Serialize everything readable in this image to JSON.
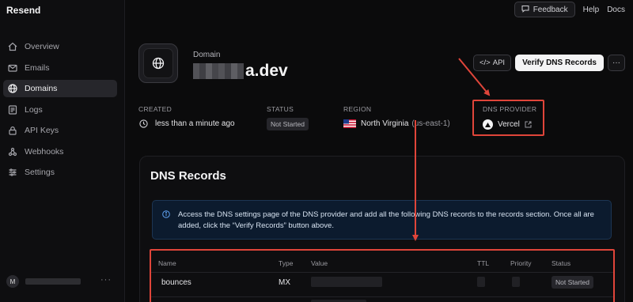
{
  "app": {
    "brand": "Resend"
  },
  "sidebar": {
    "items": [
      {
        "label": "Overview",
        "icon": "overview-icon",
        "active": false
      },
      {
        "label": "Emails",
        "icon": "mail-icon",
        "active": false
      },
      {
        "label": "Domains",
        "icon": "globe-icon",
        "active": true
      },
      {
        "label": "Logs",
        "icon": "logs-icon",
        "active": false
      },
      {
        "label": "API Keys",
        "icon": "lock-icon",
        "active": false
      },
      {
        "label": "Webhooks",
        "icon": "webhook-icon",
        "active": false
      },
      {
        "label": "Settings",
        "icon": "settings-icon",
        "active": false
      }
    ],
    "user_initial": "M",
    "user_menu": "···"
  },
  "topbar": {
    "feedback_label": "Feedback",
    "help_label": "Help",
    "docs_label": "Docs"
  },
  "header": {
    "domain_label": "Domain",
    "domain_suffix": "a.dev",
    "api_label": "API",
    "api_icon": "</>",
    "verify_label": "Verify DNS Records",
    "more_label": "···"
  },
  "meta": {
    "created_label": "CREATED",
    "created_value": "less than a minute ago",
    "status_label": "STATUS",
    "status_value": "Not Started",
    "region_label": "REGION",
    "region_value": "North Virginia",
    "region_code": "(us-east-1)",
    "provider_label": "DNS PROVIDER",
    "provider_value": "Vercel"
  },
  "dns_records": {
    "title": "DNS Records",
    "info_text": "Access the DNS settings page of the DNS provider and add all the following DNS records to the records section. Once all are added, click the “Verify Records” button above.",
    "columns": [
      "Name",
      "Type",
      "Value",
      "TTL",
      "Priority",
      "Status"
    ],
    "rows": [
      {
        "name": "bounces",
        "type": "MX",
        "status": "Not Started"
      }
    ]
  },
  "colors": {
    "background": "#0b0b0c",
    "annotation_red": "#e0453a",
    "info_bg": "#0c1b2e"
  }
}
